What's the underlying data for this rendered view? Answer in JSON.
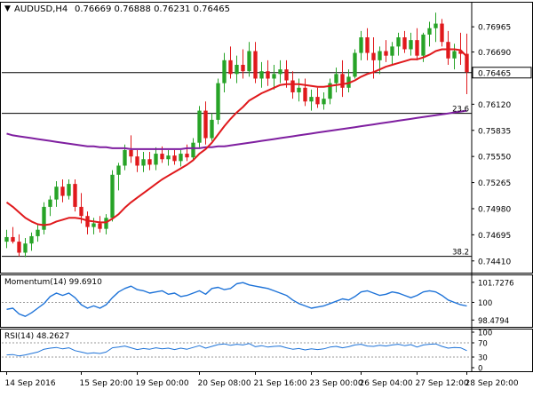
{
  "chart_data": {
    "type": "candlestick",
    "header": {
      "symbol": "AUDUSD,H4",
      "ohlc": "0.76669 0.76888 0.76231 0.76465"
    },
    "colors": {
      "bull": "#27a327",
      "bear": "#e0191c",
      "sma_short": "#e0191c",
      "sma_long": "#7f1fa0",
      "indicator_line": "#1e73d8",
      "grid_line": "#000000",
      "background": "#ffffff"
    },
    "main": {
      "yticks": [
        0.76965,
        0.7669,
        0.7612,
        0.75835,
        0.7555,
        0.75265,
        0.7498,
        0.74695,
        0.7441
      ],
      "ytick_labels": [
        "0.76965",
        "0.76690",
        "0.76120",
        "0.75835",
        "0.75550",
        "0.75265",
        "0.74980",
        "0.74695",
        "0.74410"
      ],
      "ylim": [
        0.7434,
        0.7718
      ],
      "current_price": 0.76465,
      "current_price_label": "0.76465",
      "fib_levels": [
        {
          "label": "23.6",
          "value": 0.7602
        },
        {
          "label": "38.2",
          "value": 0.7446
        }
      ],
      "candles": [
        [
          0.7462,
          0.7475,
          0.7455,
          0.7467
        ],
        [
          0.7467,
          0.7478,
          0.746,
          0.7462
        ],
        [
          0.7462,
          0.747,
          0.7446,
          0.745
        ],
        [
          0.745,
          0.7466,
          0.7445,
          0.746
        ],
        [
          0.746,
          0.7472,
          0.7452,
          0.7468
        ],
        [
          0.7468,
          0.7482,
          0.7462,
          0.7475
        ],
        [
          0.7475,
          0.7505,
          0.747,
          0.75
        ],
        [
          0.75,
          0.7512,
          0.749,
          0.7508
        ],
        [
          0.7508,
          0.7528,
          0.75,
          0.7522
        ],
        [
          0.7522,
          0.753,
          0.7505,
          0.7512
        ],
        [
          0.7512,
          0.753,
          0.7508,
          0.7525
        ],
        [
          0.7525,
          0.753,
          0.7495,
          0.75
        ],
        [
          0.75,
          0.7515,
          0.7482,
          0.749
        ],
        [
          0.749,
          0.7495,
          0.747,
          0.7478
        ],
        [
          0.7478,
          0.7488,
          0.747,
          0.7482
        ],
        [
          0.7482,
          0.749,
          0.7472,
          0.7476
        ],
        [
          0.7476,
          0.7492,
          0.747,
          0.7488
        ],
        [
          0.7488,
          0.754,
          0.7484,
          0.7535
        ],
        [
          0.7535,
          0.7548,
          0.7518,
          0.7545
        ],
        [
          0.7545,
          0.7568,
          0.754,
          0.7562
        ],
        [
          0.7562,
          0.7578,
          0.7548,
          0.7555
        ],
        [
          0.7555,
          0.7562,
          0.7538,
          0.7545
        ],
        [
          0.7545,
          0.756,
          0.7538,
          0.7552
        ],
        [
          0.7552,
          0.756,
          0.754,
          0.7546
        ],
        [
          0.7546,
          0.7565,
          0.754,
          0.7558
        ],
        [
          0.7558,
          0.7566,
          0.7548,
          0.7552
        ],
        [
          0.7552,
          0.7562,
          0.7545,
          0.7556
        ],
        [
          0.7556,
          0.7562,
          0.7546,
          0.755
        ],
        [
          0.755,
          0.7562,
          0.7544,
          0.7558
        ],
        [
          0.7558,
          0.7568,
          0.755,
          0.7554
        ],
        [
          0.7554,
          0.7575,
          0.755,
          0.757
        ],
        [
          0.757,
          0.761,
          0.7565,
          0.7605
        ],
        [
          0.7605,
          0.7615,
          0.7568,
          0.7575
        ],
        [
          0.7575,
          0.7602,
          0.7572,
          0.7595
        ],
        [
          0.7595,
          0.764,
          0.759,
          0.7635
        ],
        [
          0.7635,
          0.7668,
          0.7625,
          0.766
        ],
        [
          0.766,
          0.7675,
          0.764,
          0.7645
        ],
        [
          0.7645,
          0.7665,
          0.7635,
          0.7655
        ],
        [
          0.7655,
          0.7672,
          0.764,
          0.7648
        ],
        [
          0.7648,
          0.768,
          0.7642,
          0.767
        ],
        [
          0.767,
          0.768,
          0.7635,
          0.764
        ],
        [
          0.764,
          0.7658,
          0.763,
          0.7648
        ],
        [
          0.7648,
          0.766,
          0.7632,
          0.764
        ],
        [
          0.764,
          0.7655,
          0.7628,
          0.7645
        ],
        [
          0.7645,
          0.766,
          0.7635,
          0.765
        ],
        [
          0.765,
          0.766,
          0.763,
          0.7638
        ],
        [
          0.7638,
          0.7648,
          0.7618,
          0.7625
        ],
        [
          0.7625,
          0.764,
          0.7615,
          0.763
        ],
        [
          0.763,
          0.764,
          0.761,
          0.7615
        ],
        [
          0.7615,
          0.7628,
          0.7605,
          0.762
        ],
        [
          0.762,
          0.763,
          0.7608,
          0.7612
        ],
        [
          0.7612,
          0.7625,
          0.7606,
          0.7618
        ],
        [
          0.7618,
          0.764,
          0.7612,
          0.7635
        ],
        [
          0.7635,
          0.7652,
          0.7625,
          0.7645
        ],
        [
          0.7645,
          0.766,
          0.762,
          0.763
        ],
        [
          0.763,
          0.765,
          0.7625,
          0.7642
        ],
        [
          0.7642,
          0.7672,
          0.764,
          0.7668
        ],
        [
          0.7668,
          0.7692,
          0.766,
          0.7685
        ],
        [
          0.7685,
          0.7695,
          0.766,
          0.7668
        ],
        [
          0.7668,
          0.7685,
          0.764,
          0.766
        ],
        [
          0.766,
          0.7675,
          0.7645,
          0.767
        ],
        [
          0.767,
          0.7682,
          0.7658,
          0.7665
        ],
        [
          0.7665,
          0.768,
          0.7655,
          0.7675
        ],
        [
          0.7675,
          0.769,
          0.7665,
          0.7685
        ],
        [
          0.7685,
          0.7692,
          0.7668,
          0.7672
        ],
        [
          0.7672,
          0.769,
          0.7665,
          0.7682
        ],
        [
          0.7682,
          0.7695,
          0.766,
          0.7665
        ],
        [
          0.7665,
          0.769,
          0.7658,
          0.7688
        ],
        [
          0.7688,
          0.7702,
          0.7675,
          0.7695
        ],
        [
          0.7695,
          0.7712,
          0.768,
          0.77
        ],
        [
          0.77,
          0.7705,
          0.7675,
          0.768
        ],
        [
          0.768,
          0.7692,
          0.7655,
          0.7662
        ],
        [
          0.7662,
          0.7678,
          0.765,
          0.767
        ],
        [
          0.767,
          0.769,
          0.7655,
          0.7667
        ],
        [
          0.7667,
          0.7689,
          0.7623,
          0.7647
        ]
      ],
      "sma_short": [
        0.7505,
        0.75,
        0.7494,
        0.7488,
        0.7484,
        0.7481,
        0.748,
        0.7481,
        0.7484,
        0.7486,
        0.7488,
        0.7488,
        0.7487,
        0.7485,
        0.7484,
        0.7483,
        0.7483,
        0.7487,
        0.7492,
        0.7499,
        0.7505,
        0.751,
        0.7515,
        0.752,
        0.7525,
        0.753,
        0.7534,
        0.7538,
        0.7542,
        0.7546,
        0.7551,
        0.7558,
        0.7563,
        0.757,
        0.7579,
        0.7588,
        0.7596,
        0.7603,
        0.7609,
        0.7616,
        0.762,
        0.7624,
        0.7627,
        0.763,
        0.7633,
        0.7634,
        0.7634,
        0.7634,
        0.7633,
        0.7632,
        0.7631,
        0.7631,
        0.7632,
        0.7633,
        0.7634,
        0.7635,
        0.7638,
        0.7642,
        0.7645,
        0.7647,
        0.765,
        0.7653,
        0.7655,
        0.7657,
        0.7659,
        0.7661,
        0.7661,
        0.7663,
        0.7666,
        0.767,
        0.7672,
        0.7672,
        0.7672,
        0.7671,
        0.7664
      ],
      "sma_long": [
        0.758,
        0.7578,
        0.7577,
        0.7576,
        0.7575,
        0.7574,
        0.7573,
        0.7572,
        0.7571,
        0.757,
        0.7569,
        0.7568,
        0.7567,
        0.7566,
        0.7566,
        0.7565,
        0.7565,
        0.7564,
        0.7564,
        0.7564,
        0.7563,
        0.7563,
        0.7563,
        0.7563,
        0.7563,
        0.7563,
        0.7563,
        0.7563,
        0.7563,
        0.7564,
        0.7564,
        0.7564,
        0.7565,
        0.7565,
        0.7566,
        0.7566,
        0.7567,
        0.7568,
        0.7569,
        0.757,
        0.7571,
        0.7572,
        0.7573,
        0.7574,
        0.7575,
        0.7576,
        0.7577,
        0.7578,
        0.7579,
        0.758,
        0.7581,
        0.7582,
        0.7583,
        0.7584,
        0.7585,
        0.7586,
        0.7587,
        0.7588,
        0.7589,
        0.759,
        0.7591,
        0.7592,
        0.7593,
        0.7594,
        0.7595,
        0.7596,
        0.7597,
        0.7598,
        0.7599,
        0.76,
        0.7601,
        0.7602,
        0.7603,
        0.7604,
        0.7605
      ]
    },
    "momentum": {
      "label": "Momentum(14) 99.6910",
      "yticks": [
        101.7276,
        100,
        98.4794
      ],
      "ytick_labels": [
        "101.7276",
        "100",
        "98.4794"
      ],
      "ylim": [
        98.2,
        102.1
      ],
      "ref_level": 100,
      "values": [
        99.4,
        99.5,
        99.0,
        98.8,
        99.1,
        99.5,
        99.9,
        100.5,
        100.8,
        100.6,
        100.8,
        100.4,
        99.8,
        99.5,
        99.7,
        99.5,
        99.8,
        100.4,
        100.9,
        101.2,
        101.4,
        101.1,
        101.0,
        100.8,
        100.9,
        101.0,
        100.7,
        100.8,
        100.5,
        100.6,
        100.8,
        101.0,
        100.7,
        101.2,
        101.3,
        101.1,
        101.2,
        101.6,
        101.7,
        101.5,
        101.4,
        101.3,
        101.2,
        101.0,
        100.8,
        100.6,
        100.2,
        99.9,
        99.7,
        99.5,
        99.6,
        99.7,
        99.9,
        100.1,
        100.3,
        100.2,
        100.5,
        100.9,
        101.0,
        100.8,
        100.6,
        100.7,
        100.9,
        100.8,
        100.6,
        100.4,
        100.6,
        100.9,
        101.0,
        100.9,
        100.6,
        100.2,
        100.0,
        99.8,
        99.69
      ]
    },
    "rsi": {
      "label": "RSI(14) 48.2627",
      "yticks": [
        100,
        70,
        30,
        0
      ],
      "ytick_labels": [
        "100",
        "70",
        "30",
        "0"
      ],
      "dashed_levels": [
        70,
        30
      ],
      "ylim": [
        0,
        100
      ],
      "values": [
        36,
        37,
        33,
        36,
        40,
        44,
        52,
        55,
        57,
        53,
        56,
        48,
        44,
        40,
        42,
        40,
        44,
        56,
        58,
        61,
        56,
        51,
        54,
        52,
        56,
        53,
        55,
        51,
        55,
        52,
        57,
        62,
        55,
        60,
        65,
        67,
        63,
        66,
        64,
        68,
        59,
        62,
        58,
        60,
        61,
        56,
        52,
        54,
        50,
        53,
        51,
        53,
        58,
        60,
        56,
        59,
        64,
        66,
        61,
        60,
        63,
        61,
        64,
        66,
        62,
        65,
        58,
        64,
        66,
        67,
        60,
        55,
        57,
        56,
        48
      ]
    },
    "xticks": [
      {
        "index": 0,
        "label": "14 Sep 2016"
      },
      {
        "index": 12,
        "label": "15 Sep 20:00"
      },
      {
        "index": 21,
        "label": "19 Sep 00:00"
      },
      {
        "index": 31,
        "label": "20 Sep 08:00"
      },
      {
        "index": 40,
        "label": "21 Sep 16:00"
      },
      {
        "index": 49,
        "label": "23 Sep 00:00"
      },
      {
        "index": 57,
        "label": "26 Sep 04:00"
      },
      {
        "index": 66,
        "label": "27 Sep 12:00"
      },
      {
        "index": 74,
        "label": "28 Sep 20:00"
      }
    ]
  }
}
